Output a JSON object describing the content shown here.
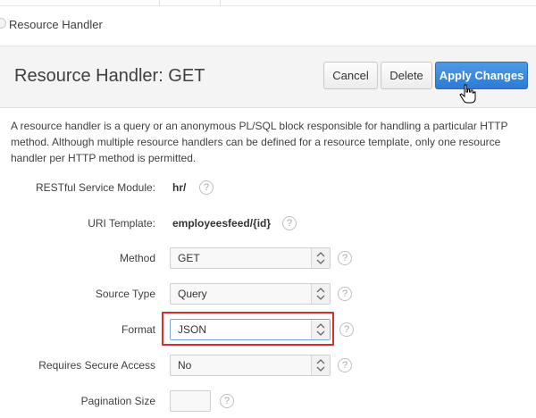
{
  "breadcrumb": {
    "current": "Resource Handler"
  },
  "header": {
    "title": "Resource Handler: GET",
    "buttons": {
      "cancel": "Cancel",
      "delete": "Delete",
      "apply": "Apply Changes"
    }
  },
  "description": "A resource handler is a query or an anonymous PL/SQL block responsible for handling a particular HTTP method. Although multiple resource handlers can be defined for a resource template, only one resource handler per HTTP method is permitted.",
  "fields": {
    "module": {
      "label": "RESTful Service Module:",
      "value": "hr/"
    },
    "uri": {
      "label": "URI Template:",
      "value": "employeesfeed/{id}"
    },
    "method": {
      "label": "Method",
      "value": "GET"
    },
    "source_type": {
      "label": "Source Type",
      "value": "Query"
    },
    "format": {
      "label": "Format",
      "value": "JSON"
    },
    "secure": {
      "label": "Requires Secure Access",
      "value": "No"
    },
    "pagination": {
      "label": "Pagination Size",
      "value": ""
    }
  },
  "help_glyph": "?",
  "colors": {
    "primary": "#2d7bd2",
    "highlight": "#e02a2a"
  }
}
